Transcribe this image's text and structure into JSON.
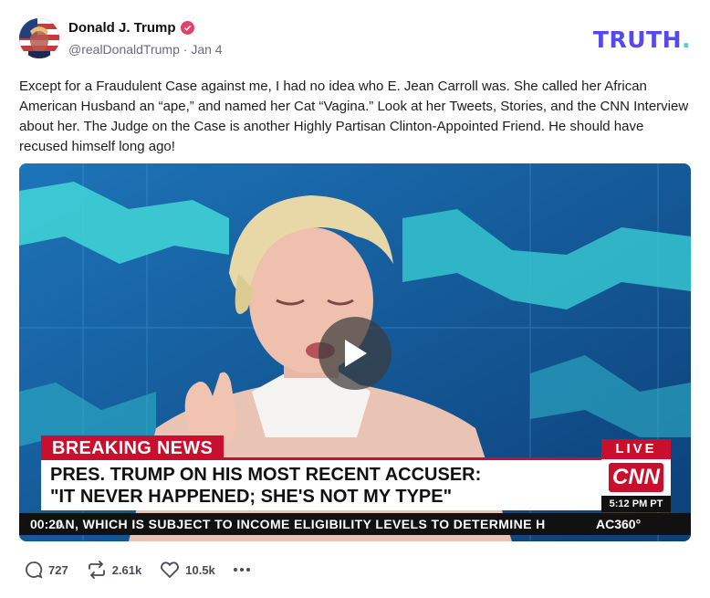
{
  "author": {
    "name": "Donald J. Trump",
    "handle": "@realDonaldTrump",
    "date": "Jan 4",
    "separator": "·"
  },
  "brand": {
    "text": "TRUTH",
    "dot": ".",
    "color": "#5448ee"
  },
  "post": {
    "text": "Except for a Fraudulent Case against me, I had no idea who E. Jean Carroll was. She called her African American Husband an “ape,” and named her Cat “Vagina.” Look at her Tweets, Stories, and the CNN Interview about her. The Judge on the Case is another Highly Partisan Clinton-Appointed Friend. He should have recused himself long ago!"
  },
  "video": {
    "breaking_label": "BREAKING NEWS",
    "headline_line1": "PRES. TRUMP ON HIS MOST RECENT ACCUSER:",
    "headline_line2": "\"IT NEVER HAPPENED; SHE'S NOT MY TYPE\"",
    "live_label": "LIVE",
    "network": "CNN",
    "time": "5:12 PM PT",
    "ticker": "AN, WHICH IS SUBJECT TO INCOME ELIGIBILITY LEVELS TO DETERMINE H",
    "show": "AC360°",
    "timecode": "00:20"
  },
  "actions": {
    "replies": "727",
    "retruths": "2.61k",
    "likes": "10.5k"
  },
  "icons": [
    "verified-badge-icon",
    "play-icon",
    "reply-icon",
    "retruth-icon",
    "like-icon",
    "more-icon"
  ]
}
